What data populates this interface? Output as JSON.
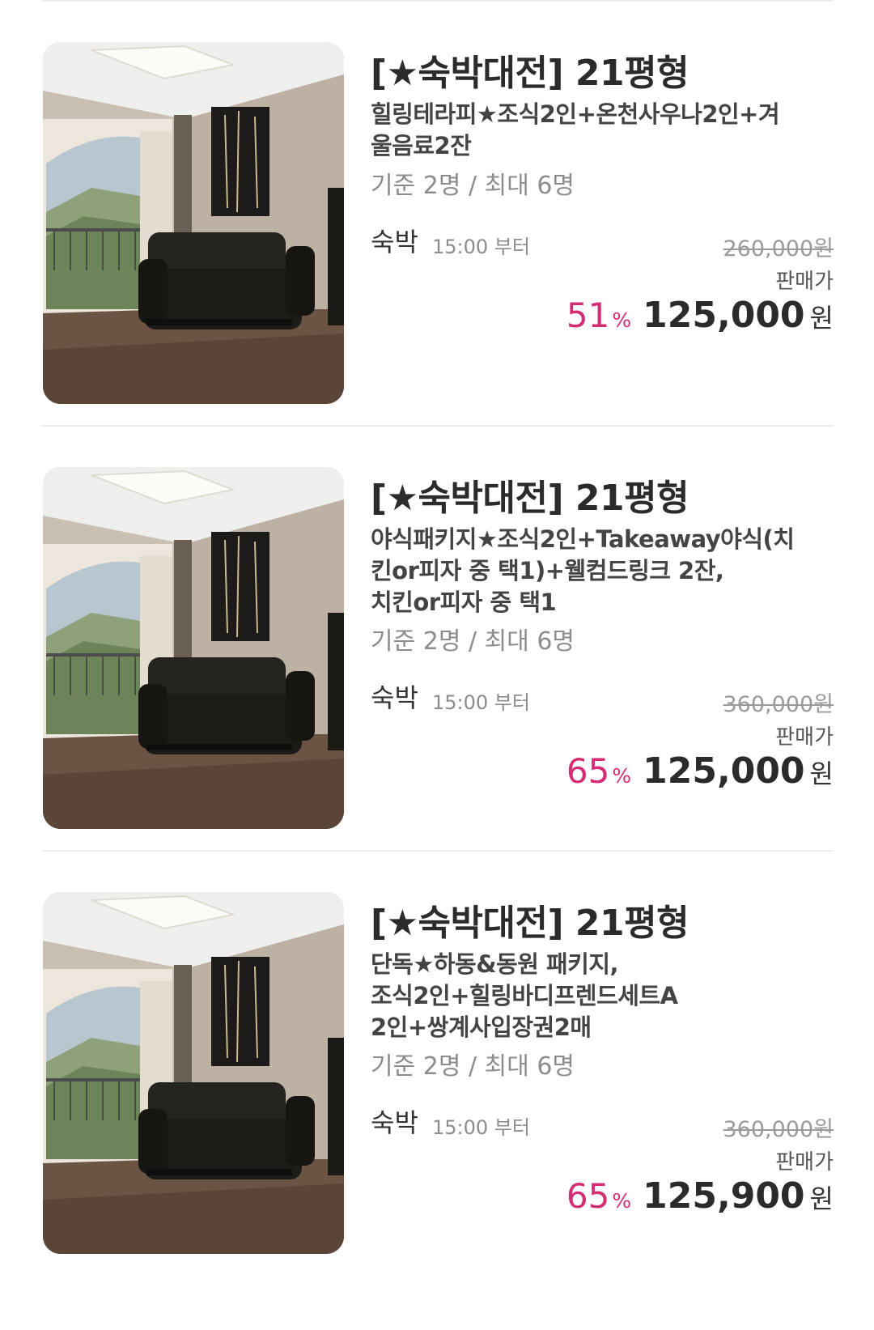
{
  "rooms": [
    {
      "title": "[★숙박대전] 21평형",
      "desc_lines": [
        "힐링테라피★조식2인+온천사우나2인+겨",
        "울음료2잔"
      ],
      "capacity": "기준 2명 / 최대 6명",
      "stay_label": "숙박",
      "checkin": "15:00 부터",
      "original_price": "260,000원",
      "sale_label": "판매가",
      "discount": "51",
      "discount_unit": "%",
      "price": "125,000",
      "currency": "원"
    },
    {
      "title": "[★숙박대전] 21평형",
      "desc_lines": [
        "야식패키지★조식2인+Takeaway야식(치",
        "킨or피자 중 택1)+웰컴드링크 2잔,",
        "치킨or피자 중 택1"
      ],
      "capacity": "기준 2명 / 최대 6명",
      "stay_label": "숙박",
      "checkin": "15:00 부터",
      "original_price": "360,000원",
      "sale_label": "판매가",
      "discount": "65",
      "discount_unit": "%",
      "price": "125,000",
      "currency": "원"
    },
    {
      "title": "[★숙박대전] 21평형",
      "desc_lines": [
        "단독★하동&동원 패키지,",
        "조식2인+힐링바디프렌드세트A",
        "2인+쌍계사입장권2매"
      ],
      "capacity": "기준 2명 / 최대 6명",
      "stay_label": "숙박",
      "checkin": "15:00 부터",
      "original_price": "360,000원",
      "sale_label": "판매가",
      "discount": "65",
      "discount_unit": "%",
      "price": "125,900",
      "currency": "원"
    }
  ]
}
